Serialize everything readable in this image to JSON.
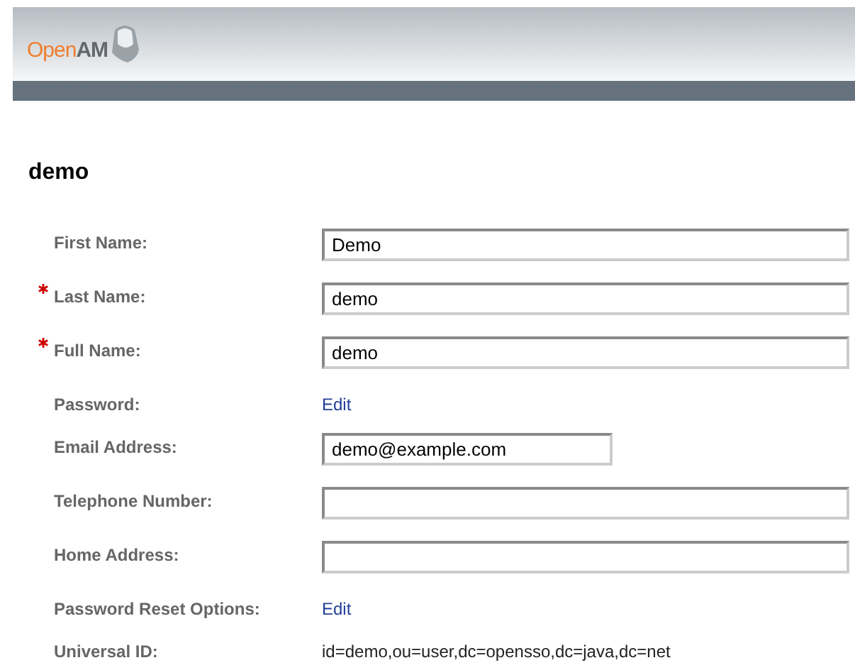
{
  "header": {
    "logo_text": "Open**AM**"
  },
  "title": "demo",
  "rows": [
    {
      "label": "First Name:",
      "required": false,
      "kind": "field",
      "value": "Demo"
    },
    {
      "label": "Last Name:",
      "required": true,
      "kind": "field",
      "value": "demo"
    },
    {
      "label": "Full Name:",
      "required": true,
      "kind": "field",
      "value": "demo"
    },
    {
      "label": "Password:",
      "required": false,
      "kind": "link",
      "value": "Edit"
    },
    {
      "label": "Email Address:",
      "required": false,
      "kind": "short-field",
      "value": "demo@example.com"
    },
    {
      "label": "Telephone Number:",
      "required": false,
      "kind": "field"
    },
    {
      "label": "Home Address:",
      "required": false,
      "kind": "field"
    },
    {
      "label": "Password Reset Options:",
      "required": false,
      "kind": "link",
      "value": "Edit"
    },
    {
      "label": "Universal ID:",
      "required": false,
      "kind": "text",
      "value": "id=demo,ou=user,dc=opensso,dc=java,dc=net"
    }
  ]
}
